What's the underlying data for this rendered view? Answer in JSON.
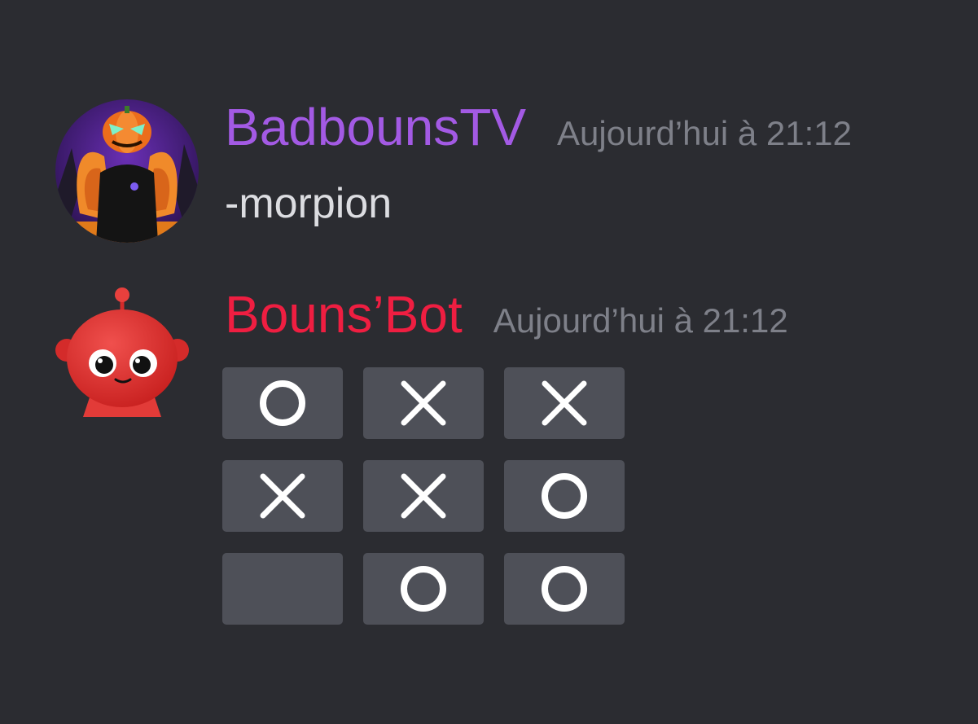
{
  "colors": {
    "background": "#2b2c31",
    "user_name_color": "#a35ae4",
    "bot_name_color": "#ef1e41",
    "timestamp_color": "#7e8089",
    "cell_background": "#4e5058",
    "mark_color": "#ffffff"
  },
  "messages": [
    {
      "author": "BadbounsTV",
      "timestamp": "Aujourd’hui à 21:12",
      "text": "-morpion",
      "avatar": "pumpkin-head-avatar"
    },
    {
      "author": "Bouns’Bot",
      "timestamp": "Aujourd’hui à 21:12",
      "avatar": "red-robot-avatar",
      "board": [
        [
          "O",
          "X",
          "X"
        ],
        [
          "X",
          "X",
          "O"
        ],
        [
          "",
          "O",
          "O"
        ]
      ]
    }
  ]
}
